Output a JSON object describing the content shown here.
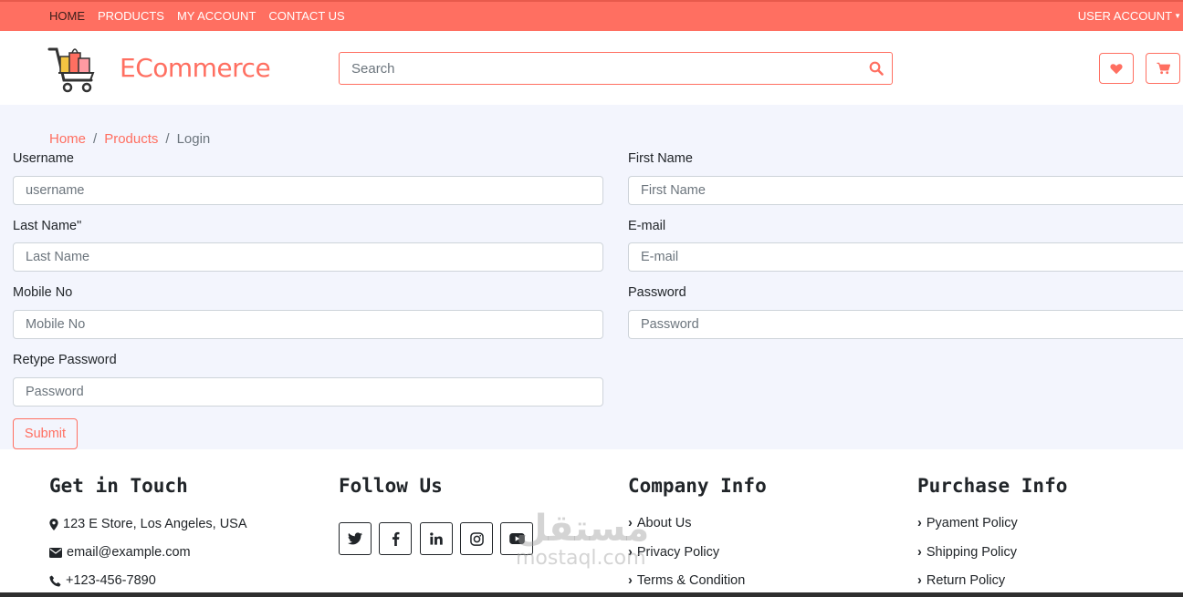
{
  "topnav": {
    "items": [
      "HOME",
      "PRODUCTS",
      "MY ACCOUNT",
      "CONTACT US"
    ],
    "active": "HOME",
    "user_account": "USER ACCOUNT"
  },
  "header": {
    "brand": "ECommerce",
    "search_placeholder": "Search"
  },
  "breadcrumb": {
    "home": "Home",
    "products": "Products",
    "current": "Login",
    "separator": "/"
  },
  "form": {
    "username_label": "Username",
    "username_placeholder": "username",
    "first_name_label": "First Name",
    "first_name_placeholder": "First Name",
    "last_name_label": "Last Name\"",
    "last_name_placeholder": "Last Name",
    "email_label": "E-mail",
    "email_placeholder": "E-mail",
    "mobile_label": "Mobile No",
    "mobile_placeholder": "Mobile No",
    "password_label": "Password",
    "password_placeholder": "Password",
    "retype_label": "Retype Password",
    "retype_placeholder": "Password",
    "submit_label": "Submit"
  },
  "footer": {
    "get_in_touch": {
      "title": "Get in Touch",
      "address": "123 E Store, Los Angeles, USA",
      "email": "email@example.com",
      "phone": "+123-456-7890"
    },
    "follow_us": {
      "title": "Follow Us",
      "icons": [
        "twitter-icon",
        "facebook-icon",
        "linkedin-icon",
        "instagram-icon",
        "youtube-icon"
      ]
    },
    "company_info": {
      "title": "Company Info",
      "links": [
        "About Us",
        "Privacy Policy",
        "Terms & Condition"
      ]
    },
    "purchase_info": {
      "title": "Purchase Info",
      "links": [
        "Pyament Policy",
        "Shipping Policy",
        "Return Policy"
      ]
    }
  },
  "watermark": {
    "arabic": "مستقل",
    "latin": "mostaql.com"
  },
  "colors": {
    "accent": "#ff6f61",
    "page_background": "#f3f5fd",
    "text": "#212529"
  }
}
